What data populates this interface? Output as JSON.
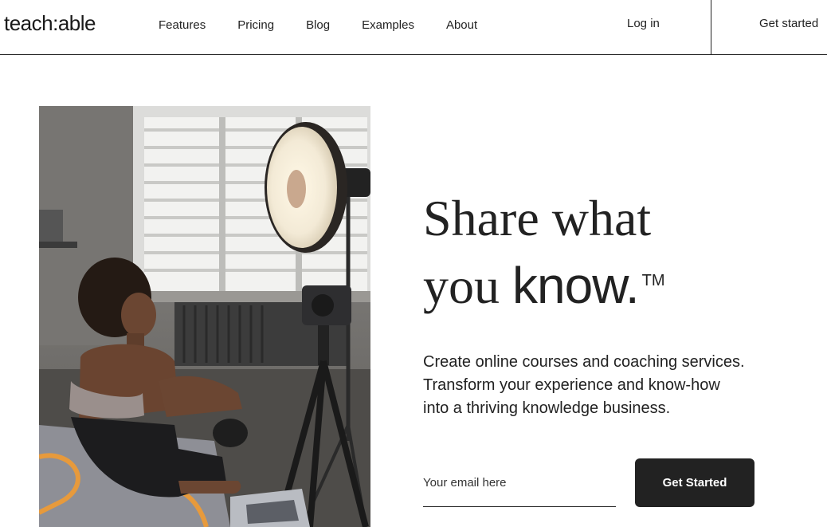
{
  "brand": {
    "logo_text": "teach:able"
  },
  "nav": {
    "items": [
      {
        "label": "Features"
      },
      {
        "label": "Pricing"
      },
      {
        "label": "Blog"
      },
      {
        "label": "Examples"
      },
      {
        "label": "About"
      }
    ],
    "login_label": "Log in",
    "get_started_label": "Get started"
  },
  "hero": {
    "headline_line1": "Share what",
    "headline_line2_a": "you ",
    "headline_line2_b": "know.",
    "trademark": "TM",
    "subtext": "Create online courses and coaching services. Transform your experience and know-how into a thriving knowledge business.",
    "email_placeholder": "Your email here",
    "cta_label": "Get Started",
    "image_alt": "Woman sitting on a yoga mat in front of a camera and ring light"
  },
  "colors": {
    "text": "#222222",
    "button_bg": "#222222",
    "button_text": "#ffffff",
    "background": "#ffffff"
  }
}
